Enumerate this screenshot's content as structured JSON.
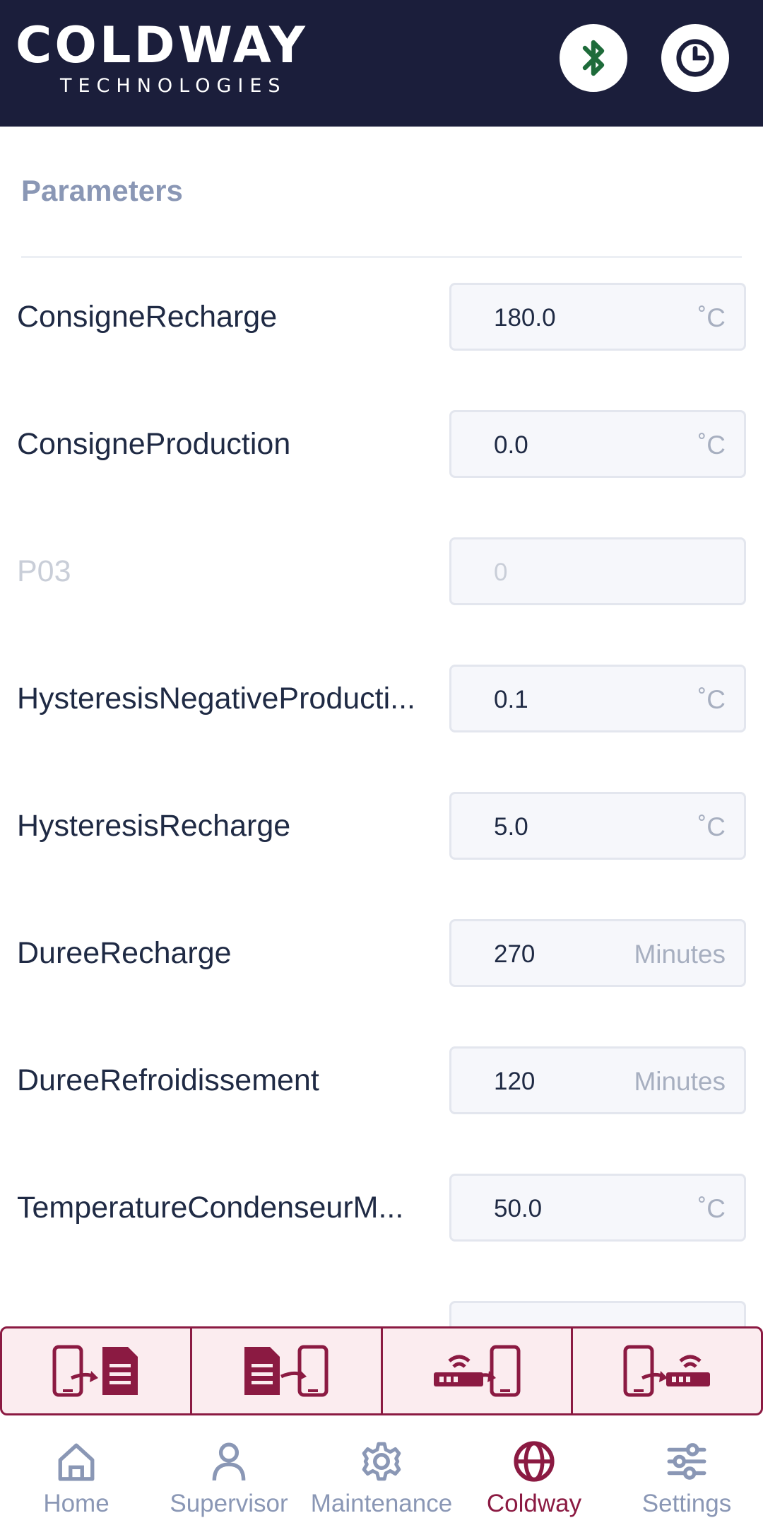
{
  "header": {
    "brand_main": "COLDWAY",
    "brand_sub": "TECHNOLOGIES",
    "bluetooth_icon": "bluetooth-icon",
    "clock_icon": "clock-icon"
  },
  "section": {
    "title": "Parameters"
  },
  "params": [
    {
      "label": "ConsigneRecharge",
      "value": "180.0",
      "unit": "˚C",
      "disabled": false
    },
    {
      "label": "ConsigneProduction",
      "value": "0.0",
      "unit": "˚C",
      "disabled": false
    },
    {
      "label": "P03",
      "value": "0",
      "unit": "",
      "disabled": true
    },
    {
      "label": "HysteresisNegativeProducti...",
      "value": "0.1",
      "unit": "˚C",
      "disabled": false
    },
    {
      "label": "HysteresisRecharge",
      "value": "5.0",
      "unit": "˚C",
      "disabled": false
    },
    {
      "label": "DureeRecharge",
      "value": "270",
      "unit": "Minutes",
      "disabled": false
    },
    {
      "label": "DureeRefroidissement",
      "value": "120",
      "unit": "Minutes",
      "disabled": false
    },
    {
      "label": "TemperatureCondenseurM...",
      "value": "50.0",
      "unit": "˚C",
      "disabled": false
    }
  ],
  "actions": [
    {
      "icon": "phone-to-document-icon"
    },
    {
      "icon": "document-to-phone-icon"
    },
    {
      "icon": "device-to-phone-icon"
    },
    {
      "icon": "phone-to-device-icon"
    }
  ],
  "nav": [
    {
      "label": "Home",
      "icon": "home-icon",
      "active": false
    },
    {
      "label": "Supervisor",
      "icon": "person-icon",
      "active": false
    },
    {
      "label": "Maintenance",
      "icon": "gear-icon",
      "active": false
    },
    {
      "label": "Coldway",
      "icon": "globe-icon",
      "active": true
    },
    {
      "label": "Settings",
      "icon": "sliders-icon",
      "active": false
    }
  ],
  "colors": {
    "header_bg": "#1b1e3b",
    "accent": "#8b1a42",
    "bluetooth_green": "#1e6b3a",
    "muted": "#8a97b5"
  }
}
